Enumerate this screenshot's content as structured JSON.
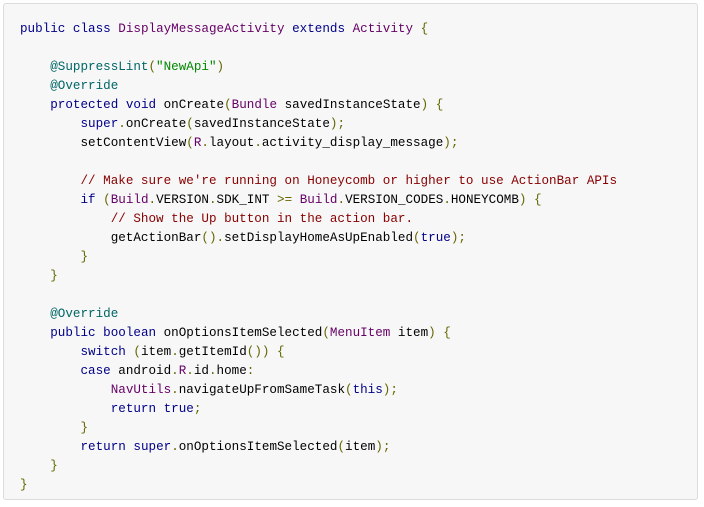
{
  "colors": {
    "keyword": "#000088",
    "type": "#660066",
    "annotation": "#006666",
    "string": "#008800",
    "comment": "#880000",
    "punctuation": "#666600",
    "plain": "#000000",
    "background": "#f7f7f7",
    "border": "#dcdcdc"
  },
  "code": {
    "language": "java",
    "lines": [
      [
        [
          "kw",
          "public"
        ],
        [
          "pl",
          " "
        ],
        [
          "kw",
          "class"
        ],
        [
          "pl",
          " "
        ],
        [
          "ty",
          "DisplayMessageActivity"
        ],
        [
          "pl",
          " "
        ],
        [
          "kw",
          "extends"
        ],
        [
          "pl",
          " "
        ],
        [
          "ty",
          "Activity"
        ],
        [
          "pl",
          " "
        ],
        [
          "pu",
          "{"
        ]
      ],
      [],
      [
        [
          "pl",
          "    "
        ],
        [
          "an",
          "@SuppressLint"
        ],
        [
          "pu",
          "("
        ],
        [
          "st",
          "\"NewApi\""
        ],
        [
          "pu",
          ")"
        ]
      ],
      [
        [
          "pl",
          "    "
        ],
        [
          "an",
          "@Override"
        ]
      ],
      [
        [
          "pl",
          "    "
        ],
        [
          "kw",
          "protected"
        ],
        [
          "pl",
          " "
        ],
        [
          "kw",
          "void"
        ],
        [
          "pl",
          " onCreate"
        ],
        [
          "pu",
          "("
        ],
        [
          "ty",
          "Bundle"
        ],
        [
          "pl",
          " savedInstanceState"
        ],
        [
          "pu",
          ")"
        ],
        [
          "pl",
          " "
        ],
        [
          "pu",
          "{"
        ]
      ],
      [
        [
          "pl",
          "        "
        ],
        [
          "kw",
          "super"
        ],
        [
          "pu",
          "."
        ],
        [
          "pl",
          "onCreate"
        ],
        [
          "pu",
          "("
        ],
        [
          "pl",
          "savedInstanceState"
        ],
        [
          "pu",
          ");"
        ]
      ],
      [
        [
          "pl",
          "        setContentView"
        ],
        [
          "pu",
          "("
        ],
        [
          "ty",
          "R"
        ],
        [
          "pu",
          "."
        ],
        [
          "pl",
          "layout"
        ],
        [
          "pu",
          "."
        ],
        [
          "pl",
          "activity_display_message"
        ],
        [
          "pu",
          ");"
        ]
      ],
      [],
      [
        [
          "pl",
          "        "
        ],
        [
          "co",
          "// Make sure we're running on Honeycomb or higher to use ActionBar APIs"
        ]
      ],
      [
        [
          "pl",
          "        "
        ],
        [
          "kw",
          "if"
        ],
        [
          "pl",
          " "
        ],
        [
          "pu",
          "("
        ],
        [
          "ty",
          "Build"
        ],
        [
          "pu",
          "."
        ],
        [
          "pl",
          "VERSION"
        ],
        [
          "pu",
          "."
        ],
        [
          "pl",
          "SDK_INT "
        ],
        [
          "pu",
          ">="
        ],
        [
          "pl",
          " "
        ],
        [
          "ty",
          "Build"
        ],
        [
          "pu",
          "."
        ],
        [
          "pl",
          "VERSION_CODES"
        ],
        [
          "pu",
          "."
        ],
        [
          "pl",
          "HONEYCOMB"
        ],
        [
          "pu",
          ")"
        ],
        [
          "pl",
          " "
        ],
        [
          "pu",
          "{"
        ]
      ],
      [
        [
          "pl",
          "            "
        ],
        [
          "co",
          "// Show the Up button in the action bar."
        ]
      ],
      [
        [
          "pl",
          "            getActionBar"
        ],
        [
          "pu",
          "()."
        ],
        [
          "pl",
          "setDisplayHomeAsUpEnabled"
        ],
        [
          "pu",
          "("
        ],
        [
          "kw",
          "true"
        ],
        [
          "pu",
          ");"
        ]
      ],
      [
        [
          "pl",
          "        "
        ],
        [
          "pu",
          "}"
        ]
      ],
      [
        [
          "pl",
          "    "
        ],
        [
          "pu",
          "}"
        ]
      ],
      [],
      [
        [
          "pl",
          "    "
        ],
        [
          "an",
          "@Override"
        ]
      ],
      [
        [
          "pl",
          "    "
        ],
        [
          "kw",
          "public"
        ],
        [
          "pl",
          " "
        ],
        [
          "kw",
          "boolean"
        ],
        [
          "pl",
          " onOptionsItemSelected"
        ],
        [
          "pu",
          "("
        ],
        [
          "ty",
          "MenuItem"
        ],
        [
          "pl",
          " item"
        ],
        [
          "pu",
          ")"
        ],
        [
          "pl",
          " "
        ],
        [
          "pu",
          "{"
        ]
      ],
      [
        [
          "pl",
          "        "
        ],
        [
          "kw",
          "switch"
        ],
        [
          "pl",
          " "
        ],
        [
          "pu",
          "("
        ],
        [
          "pl",
          "item"
        ],
        [
          "pu",
          "."
        ],
        [
          "pl",
          "getItemId"
        ],
        [
          "pu",
          "())"
        ],
        [
          "pl",
          " "
        ],
        [
          "pu",
          "{"
        ]
      ],
      [
        [
          "pl",
          "        "
        ],
        [
          "kw",
          "case"
        ],
        [
          "pl",
          " android"
        ],
        [
          "pu",
          "."
        ],
        [
          "ty",
          "R"
        ],
        [
          "pu",
          "."
        ],
        [
          "pl",
          "id"
        ],
        [
          "pu",
          "."
        ],
        [
          "pl",
          "home"
        ],
        [
          "pu",
          ":"
        ]
      ],
      [
        [
          "pl",
          "            "
        ],
        [
          "ty",
          "NavUtils"
        ],
        [
          "pu",
          "."
        ],
        [
          "pl",
          "navigateUpFromSameTask"
        ],
        [
          "pu",
          "("
        ],
        [
          "kw",
          "this"
        ],
        [
          "pu",
          ");"
        ]
      ],
      [
        [
          "pl",
          "            "
        ],
        [
          "kw",
          "return"
        ],
        [
          "pl",
          " "
        ],
        [
          "kw",
          "true"
        ],
        [
          "pu",
          ";"
        ]
      ],
      [
        [
          "pl",
          "        "
        ],
        [
          "pu",
          "}"
        ]
      ],
      [
        [
          "pl",
          "        "
        ],
        [
          "kw",
          "return"
        ],
        [
          "pl",
          " "
        ],
        [
          "kw",
          "super"
        ],
        [
          "pu",
          "."
        ],
        [
          "pl",
          "onOptionsItemSelected"
        ],
        [
          "pu",
          "("
        ],
        [
          "pl",
          "item"
        ],
        [
          "pu",
          ");"
        ]
      ],
      [
        [
          "pl",
          "    "
        ],
        [
          "pu",
          "}"
        ]
      ],
      [
        [
          "pu",
          "}"
        ]
      ]
    ]
  }
}
